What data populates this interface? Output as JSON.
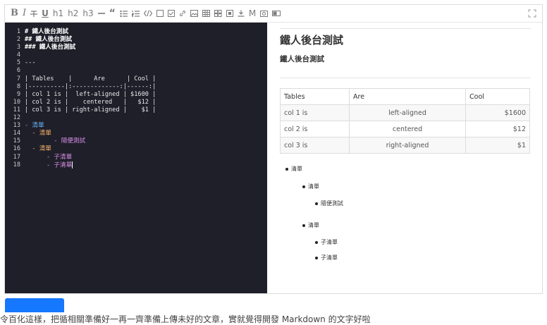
{
  "toolbar": {
    "bold": "B",
    "italic": "I",
    "underline": "U",
    "h1": "h1",
    "h2": "h2",
    "h3": "h3",
    "quote": "“",
    "md": "M"
  },
  "editor": {
    "line_numbers": [
      "1",
      "2",
      "3",
      "4",
      "5",
      "6",
      "7",
      "8",
      "9",
      "10",
      "11",
      "12",
      "13",
      "14",
      "15",
      "16",
      "17",
      "18"
    ],
    "lines": [
      "# 鐵人後台測試",
      "## 鐵人後台測試",
      "### 鐵人後台測試",
      "",
      "---",
      "",
      "| Tables    |      Are      | Cool |",
      "|----------|:-------------:|------:|",
      "| col 1 is |  left-aligned | $1600 |",
      "| col 2 is |    centered   |   $12 |",
      "| col 3 is | right-aligned |    $1 |",
      "",
      "- 清單",
      "  - 清單",
      "        - 隨便測試",
      "  - 清單",
      "      - 子清單",
      "      - 子清單"
    ]
  },
  "preview": {
    "h1": "鐵人後台測試",
    "h2": "鐵人後台測試",
    "table": {
      "headers": [
        "Tables",
        "Are",
        "Cool"
      ],
      "rows": [
        [
          "col 1 is",
          "left-aligned",
          "$1600"
        ],
        [
          "col 2 is",
          "centered",
          "$12"
        ],
        [
          "col 3 is",
          "right-aligned",
          "$1"
        ]
      ]
    },
    "list": [
      "清單",
      "清單",
      "隨便測試",
      "清單",
      "子清單",
      "子清單"
    ]
  },
  "colors": {
    "editor_bg": "#1e1f29",
    "button": "#1677ff"
  },
  "icons": [
    "strikethrough-icon",
    "dash-icon",
    "quote-icon",
    "unordered-list-icon",
    "ordered-list-icon",
    "code-icon",
    "checkbox-icon",
    "checkbox-checked-icon",
    "link-icon",
    "image-icon",
    "table-icon",
    "grid-icon",
    "preview-icon",
    "download-icon",
    "markdown-icon",
    "camera-icon",
    "toggle-icon",
    "fullscreen-icon"
  ],
  "bottom_text": "令百化這樣，把循相關準備好一再一齊準備上傳未好的文章，實就覺得開發 Markdown 的文字好啦"
}
